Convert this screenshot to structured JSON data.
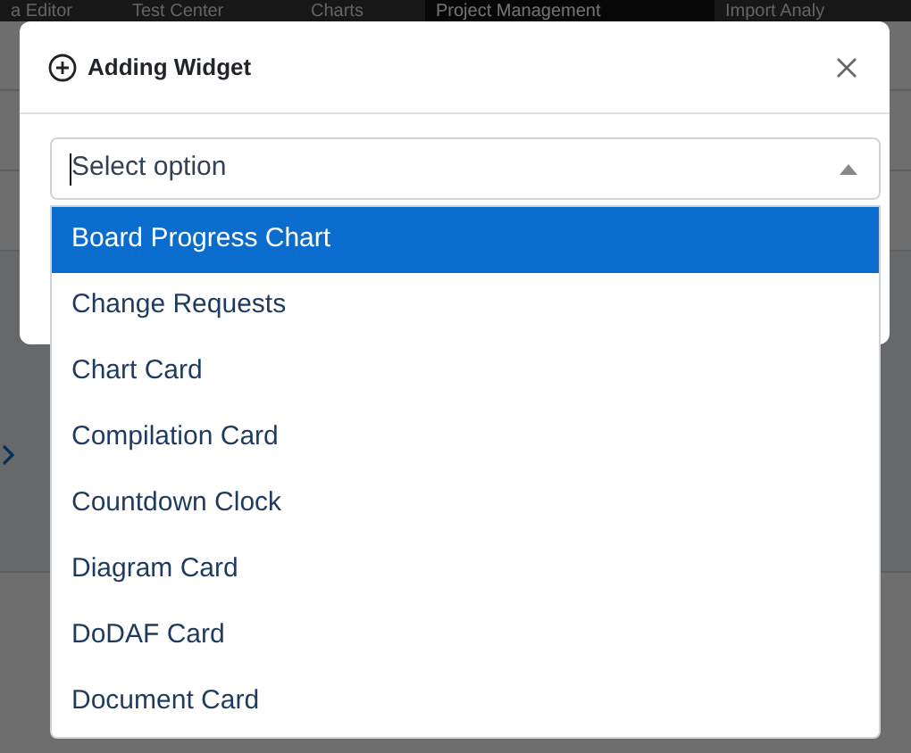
{
  "nav": {
    "items": [
      {
        "label": "a Editor",
        "selected": false
      },
      {
        "label": "Test Center",
        "selected": false
      },
      {
        "label": "Charts",
        "selected": false
      },
      {
        "label": "Project Management",
        "selected": true
      },
      {
        "label": "Import Analy",
        "selected": false
      }
    ]
  },
  "dialog": {
    "title": "Adding Widget",
    "select": {
      "placeholder": "Select option",
      "expanded": true
    },
    "options": [
      {
        "label": "Board Progress Chart",
        "selected": true
      },
      {
        "label": "Change Requests",
        "selected": false
      },
      {
        "label": "Chart Card",
        "selected": false
      },
      {
        "label": "Compilation Card",
        "selected": false
      },
      {
        "label": "Countdown Clock",
        "selected": false
      },
      {
        "label": "Diagram Card",
        "selected": false
      },
      {
        "label": "DoDAF Card",
        "selected": false
      },
      {
        "label": "Document Card",
        "selected": false
      }
    ]
  }
}
